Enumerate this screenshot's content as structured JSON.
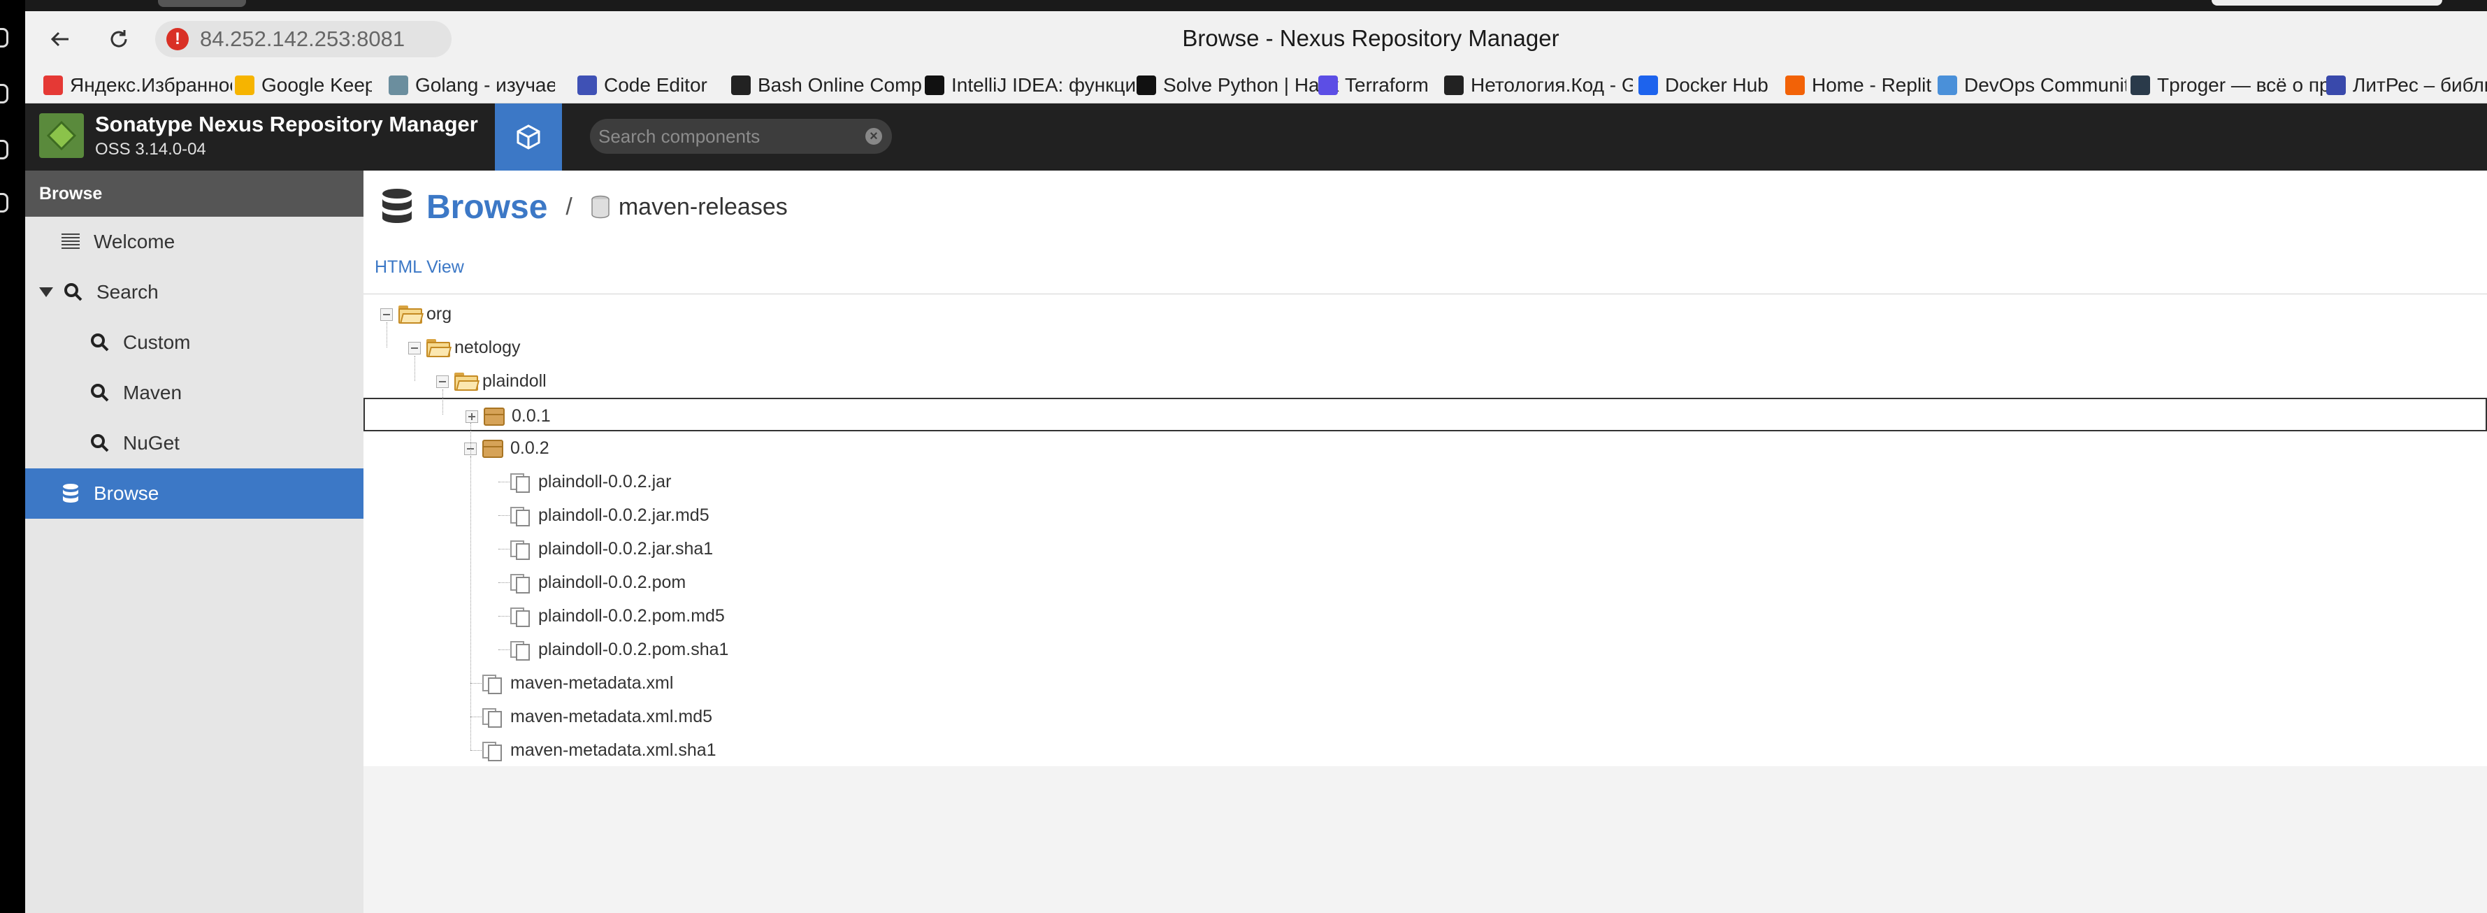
{
  "browser": {
    "url": "84.252.142.253:8081",
    "page_title": "Browse - Nexus Repository Manager",
    "bookmarks": [
      {
        "label": "Яндекс.Избранное",
        "icon": "yandex-icon",
        "color": "#e53935"
      },
      {
        "label": "Google Keep",
        "icon": "keep-icon",
        "color": "#f6b400"
      },
      {
        "label": "Golang - изучаем",
        "icon": "gopher-icon",
        "color": "#6b8e9e"
      },
      {
        "label": "Code Editor",
        "icon": "code-editor-icon",
        "color": "#3f51b5"
      },
      {
        "label": "Bash Online Compiler",
        "icon": "bash-icon",
        "color": "#222222"
      },
      {
        "label": "IntelliJ IDEA: функции",
        "icon": "intellij-icon",
        "color": "#111111"
      },
      {
        "label": "Solve Python | HackerRank",
        "icon": "hackerrank-icon",
        "color": "#111111"
      },
      {
        "label": "Terraform",
        "icon": "terraform-icon",
        "color": "#5c4ee5"
      },
      {
        "label": "Нетология.Код - Git",
        "icon": "github-icon",
        "color": "#222222"
      },
      {
        "label": "Docker Hub",
        "icon": "docker-icon",
        "color": "#1d63ed"
      },
      {
        "label": "Home - Replit",
        "icon": "replit-icon",
        "color": "#f26207"
      },
      {
        "label": "DevOps Community",
        "icon": "devops-icon",
        "color": "#4a90d9"
      },
      {
        "label": "Tproger — всё о программировании",
        "icon": "tproger-icon",
        "color": "#2a3a4a"
      },
      {
        "label": "ЛитРес – библиотека",
        "icon": "litres-icon",
        "color": "#3949ab"
      }
    ]
  },
  "app": {
    "name": "Sonatype Nexus Repository Manager",
    "version": "OSS 3.14.0-04",
    "search_placeholder": "Search components"
  },
  "sidebar": {
    "header": "Browse",
    "items": [
      {
        "label": "Welcome",
        "icon": "welcome-icon"
      },
      {
        "label": "Search",
        "icon": "search-icon"
      },
      {
        "label": "Custom",
        "icon": "search-icon"
      },
      {
        "label": "Maven",
        "icon": "search-icon"
      },
      {
        "label": "NuGet",
        "icon": "search-icon"
      },
      {
        "label": "Browse",
        "icon": "database-icon",
        "selected": true
      }
    ]
  },
  "main": {
    "title": "Browse",
    "separator": "/",
    "repository": "maven-releases",
    "html_view": "HTML View",
    "tree": [
      {
        "label": "org",
        "type": "folder-open"
      },
      {
        "label": "netology",
        "type": "folder-open"
      },
      {
        "label": "plaindoll",
        "type": "folder-open"
      },
      {
        "label": "0.0.1",
        "type": "package-collapsed"
      },
      {
        "label": "0.0.2",
        "type": "package-expanded"
      },
      {
        "label": "plaindoll-0.0.2.jar",
        "type": "file"
      },
      {
        "label": "plaindoll-0.0.2.jar.md5",
        "type": "file"
      },
      {
        "label": "plaindoll-0.0.2.jar.sha1",
        "type": "file"
      },
      {
        "label": "plaindoll-0.0.2.pom",
        "type": "file"
      },
      {
        "label": "plaindoll-0.0.2.pom.md5",
        "type": "file"
      },
      {
        "label": "plaindoll-0.0.2.pom.sha1",
        "type": "file"
      },
      {
        "label": "maven-metadata.xml",
        "type": "file"
      },
      {
        "label": "maven-metadata.xml.md5",
        "type": "file"
      },
      {
        "label": "maven-metadata.xml.sha1",
        "type": "file"
      }
    ]
  },
  "colors": {
    "accent": "#3c78c6",
    "header_bg": "#212121",
    "sidebar_bg": "#e6e6e6",
    "warning": "#d93025"
  }
}
